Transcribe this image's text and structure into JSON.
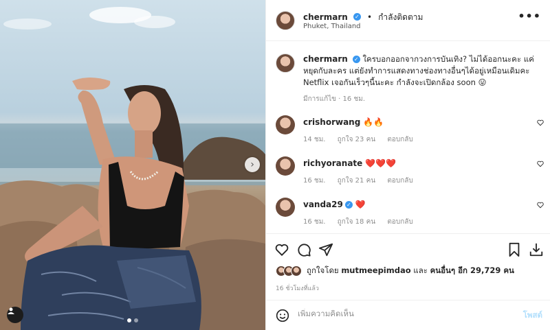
{
  "post": {
    "username": "chermarn",
    "follow_state": "กำลังติดตาม",
    "location": "Phuket, Thailand",
    "more_label": "•••"
  },
  "caption": {
    "username": "chermarn",
    "text": "ใครบอกออกจากวงการบันเทิง? ไม่ได้ออกนะคะ แค่หยุดกับละคร แต่ยังทำการแสดงทางช่องทางอื่นๆได้อยู่เหมือนเดิมคะ Netflix เจอกันเร็วๆนี้นะคะ กำลังจะเปิดกล้อง soon 😛",
    "meta": "มีการแก้ไข · 16 ชม."
  },
  "comments": [
    {
      "username": "crishorwang",
      "text": "🔥🔥",
      "time": "14 ชม.",
      "likes": "ถูกใจ 23 คน",
      "reply": "ตอบกลับ"
    },
    {
      "username": "richyoranate",
      "text": "❤️❤️❤️",
      "time": "16 ชม.",
      "likes": "ถูกใจ 21 คน",
      "reply": "ตอบกลับ"
    },
    {
      "username": "vanda29",
      "text": "❤️",
      "time": "16 ชม.",
      "likes": "ถูกใจ 18 คน",
      "reply": "ตอบกลับ"
    }
  ],
  "likes": {
    "prefix": "ถูกใจโดย",
    "user": "mutmeepimdao",
    "joiner": "และ",
    "others": "คนอื่นๆ อีก 29,729 คน"
  },
  "time_ago": "16 ชั่วโมงที่แล้ว",
  "comment_bar": {
    "placeholder": "เพิ่มความคิดเห็น",
    "post_label": "โพสต์"
  },
  "carousel": {
    "count": 2,
    "active_index": 0
  },
  "colors": {
    "accent": "#3897f0",
    "heart": "#ed4956",
    "muted": "#8e8e8e"
  },
  "icons": [
    "heart-icon",
    "comment-icon",
    "share-icon",
    "bookmark-icon",
    "download-icon",
    "emoji-icon",
    "chevron-right-icon",
    "user-tag-icon"
  ]
}
